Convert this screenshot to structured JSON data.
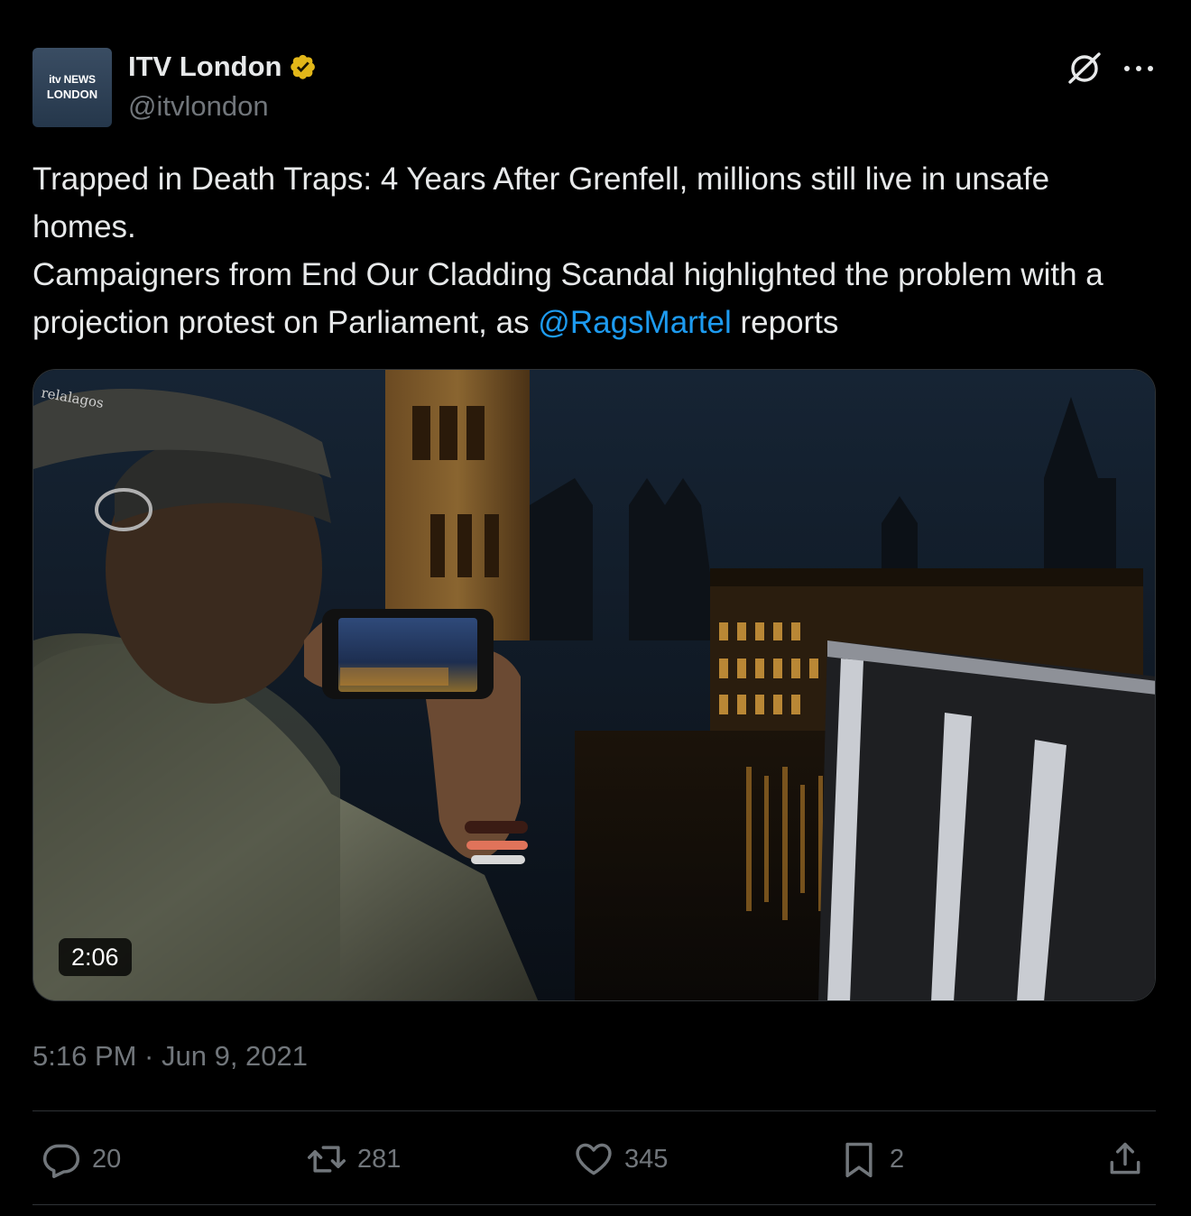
{
  "author": {
    "avatar_line1": "itv NEWS",
    "avatar_line2": "LONDON",
    "display_name": "ITV London",
    "handle": "@itvlondon"
  },
  "tweet": {
    "line1": "Trapped in Death Traps: 4 Years After Grenfell, millions still live in unsafe homes.",
    "line2_before": "Campaigners from End Our Cladding Scandal highlighted the problem with a projection protest on Parliament, as ",
    "mention": "@RagsMartel",
    "line2_after": " reports"
  },
  "media": {
    "duration": "2:06",
    "watermark": "relalagos"
  },
  "timestamp": "5:16 PM · Jun 9, 2021",
  "actions": {
    "replies": "20",
    "reposts": "281",
    "likes": "345",
    "bookmarks": "2"
  },
  "icons": {
    "verified": "verified-badge-icon",
    "grok": "grok-icon",
    "more": "more-icon",
    "reply": "reply-icon",
    "repost": "repost-icon",
    "like": "heart-icon",
    "bookmark": "bookmark-icon",
    "share": "share-icon"
  },
  "colors": {
    "background": "#000000",
    "text": "#e7e9ea",
    "secondary": "#71767b",
    "mention": "#1d9bf0",
    "badge": "#e2b719"
  }
}
